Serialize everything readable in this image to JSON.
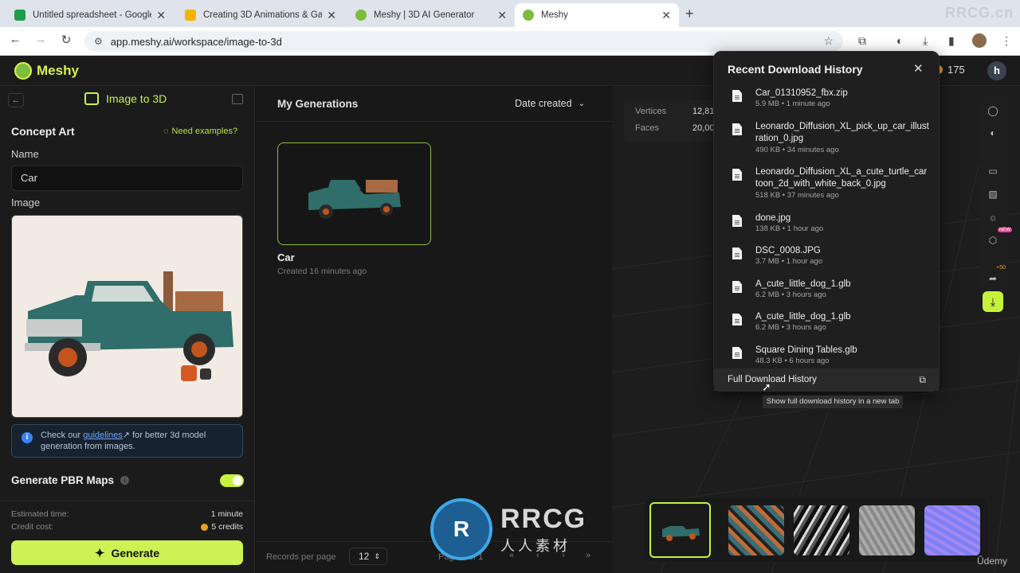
{
  "browser": {
    "tabs": [
      {
        "title": "Untitled spreadsheet - Google Sheets",
        "icon": "sheets-icon",
        "color": "#1e9e4a"
      },
      {
        "title": "Creating 3D Animations & Games",
        "icon": "slides-icon",
        "color": "#f4b400"
      },
      {
        "title": "Meshy | 3D AI Generator",
        "icon": "meshy-icon",
        "color": "#7dbd3c"
      },
      {
        "title": "Meshy",
        "icon": "meshy-icon",
        "color": "#7dbd3c"
      }
    ],
    "new_tab": "+",
    "watermark": "RRCG.cn",
    "url": "app.meshy.ai/workspace/image-to-3d"
  },
  "app": {
    "logo": "Meshy",
    "credits": "175",
    "avatar": "h"
  },
  "left_panel": {
    "title": "Image to 3D",
    "section": "Concept Art",
    "examples": "Need examples?",
    "name_label": "Name",
    "name_value": "Car",
    "image_label": "Image",
    "info_pre": "Check our",
    "info_link": "guidelines",
    "info_post": "for better 3d model generation from images.",
    "pbr_label": "Generate PBR Maps",
    "est_label": "Estimated time:",
    "est_value": "1 minute",
    "credit_label": "Credit cost:",
    "credit_value": "5 credits",
    "generate": "Generate"
  },
  "middle": {
    "title": "My Generations",
    "sort": "Date created",
    "card_name": "Car",
    "card_meta": "Created 16 minutes ago",
    "per_page_label": "Records per page",
    "per_page_value": "12",
    "page_text": "Page 1 of 1"
  },
  "viewer": {
    "vertices_label": "Vertices",
    "vertices_value": "12,81",
    "faces_label": "Faces",
    "faces_value": "20,00",
    "new_badge": "NEW",
    "plus50": "+50"
  },
  "downloads": {
    "title": "Recent Download History",
    "items": [
      {
        "name": "Car_01310952_fbx.zip",
        "meta": "5.9 MB • 1 minute ago"
      },
      {
        "name": "Leonardo_Diffusion_XL_pick_up_car_illustration_0.jpg",
        "meta": "490 KB • 34 minutes ago"
      },
      {
        "name": "Leonardo_Diffusion_XL_a_cute_turtle_cartoon_2d_with_white_back_0.jpg",
        "meta": "518 KB • 37 minutes ago"
      },
      {
        "name": "done.jpg",
        "meta": "138 KB • 1 hour ago"
      },
      {
        "name": "DSC_0008.JPG",
        "meta": "3.7 MB • 1 hour ago"
      },
      {
        "name": "A_cute_little_dog_1.glb",
        "meta": "6.2 MB • 3 hours ago"
      },
      {
        "name": "A_cute_little_dog_1.glb",
        "meta": "6.2 MB • 3 hours ago"
      },
      {
        "name": "Square Dining Tables.glb",
        "meta": "48.3 KB • 6 hours ago"
      }
    ],
    "full_history": "Full Download History",
    "tooltip": "Show full download history in a new tab"
  },
  "watermarks": {
    "logo_text": "RRCG",
    "logo_sub": "人人素材",
    "udemy": "Ûdemy"
  }
}
